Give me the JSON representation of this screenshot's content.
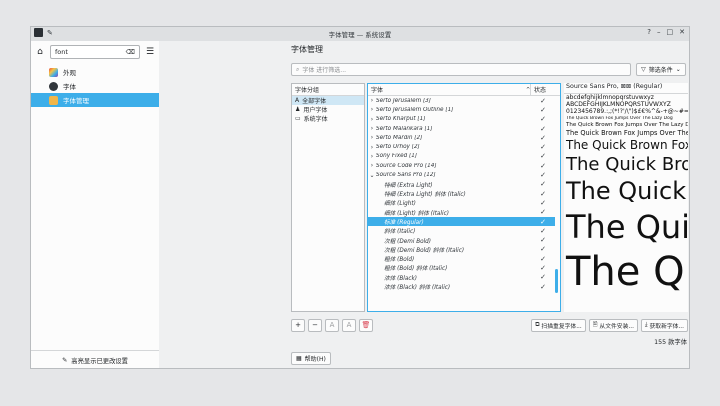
{
  "window": {
    "title": "字体管理 — 系统设置",
    "controls": [
      "?",
      "–",
      "□",
      "✕"
    ]
  },
  "sidebar": {
    "search_value": "font",
    "items": [
      {
        "label": "外观",
        "icon": "appearance-icon",
        "color": "#e94f3c"
      },
      {
        "label": "字体",
        "icon": "fonts-icon",
        "color": "#31363b"
      },
      {
        "label": "字体管理",
        "icon": "font-manager-icon",
        "color": "#f0b64a"
      }
    ],
    "footer": "高亮显示已更改设置"
  },
  "page": {
    "title": "字体管理",
    "filter_placeholder": "字体 进行筛选...",
    "filter_button": "筛选条件"
  },
  "groups": {
    "header": "字体分组",
    "items": [
      {
        "label": "全部字体",
        "icon": "A"
      },
      {
        "label": "用户字体",
        "icon": "♟"
      },
      {
        "label": "系统字体",
        "icon": "▭"
      }
    ]
  },
  "fontlist": {
    "col_font": "字体",
    "col_status": "状态",
    "rows": [
      {
        "name": "Serto Jerusalem [3]",
        "chev": "›",
        "sub": false
      },
      {
        "name": "Serto Jerusalem Outline [1]",
        "chev": "›",
        "sub": false
      },
      {
        "name": "Serto Kharput [1]",
        "chev": "›",
        "sub": false
      },
      {
        "name": "Serto Malankara [1]",
        "chev": "›",
        "sub": false
      },
      {
        "name": "Serto Mardin [2]",
        "chev": "›",
        "sub": false
      },
      {
        "name": "Serto Urhoy [2]",
        "chev": "›",
        "sub": false
      },
      {
        "name": "Sony Fixed [1]",
        "chev": "›",
        "sub": false
      },
      {
        "name": "Source Code Pro [14]",
        "chev": "›",
        "sub": false
      },
      {
        "name": "Source Sans Pro [12]",
        "chev": "⌄",
        "sub": false
      },
      {
        "name": "特细 (Extra Light)",
        "chev": "",
        "sub": true
      },
      {
        "name": "特细 (Extra Light) 斜体 (Italic)",
        "chev": "",
        "sub": true
      },
      {
        "name": "细体 (Light)",
        "chev": "",
        "sub": true
      },
      {
        "name": "细体 (Light) 斜体 (Italic)",
        "chev": "",
        "sub": true
      },
      {
        "name": "标准 (Regular)",
        "chev": "",
        "sub": true,
        "selected": true
      },
      {
        "name": "斜体 (Italic)",
        "chev": "",
        "sub": true
      },
      {
        "name": "次粗 (Demi Bold)",
        "chev": "",
        "sub": true
      },
      {
        "name": "次粗 (Demi Bold) 斜体 (Italic)",
        "chev": "",
        "sub": true
      },
      {
        "name": "粗体 (Bold)",
        "chev": "",
        "sub": true
      },
      {
        "name": "粗体 (Bold) 斜体 (Italic)",
        "chev": "",
        "sub": true
      },
      {
        "name": "浓体 (Black)",
        "chev": "",
        "sub": true
      },
      {
        "name": "浓体 (Black) 斜体 (Italic)",
        "chev": "",
        "sub": true
      }
    ],
    "check": "✓"
  },
  "preview": {
    "title": "Source Sans Pro, ⊠⊠ (Regular)",
    "lines": [
      "abcdefghijklmnopqrstuvwxyz",
      "ABCDEFGHIJKLMNOPQRSTUVWXYZ",
      "0123456789.:,;(*!?'/\\\")$£€%^&-+@~#=",
      "The Quick Brown Fox Jumps Over The Lazy Dog",
      "The Quick Brown Fox Jumps Over The Lazy Dog",
      "The Quick Brown Fox Jumps Over The Lazy Dog",
      "The Quick Brown Fox",
      "The Quick Brown",
      "The Quick",
      "The Quick",
      "The Qu"
    ]
  },
  "toolbar": {
    "add": "+",
    "remove": "−",
    "enable": "A",
    "disable": "A",
    "delete": "🗑",
    "scan": "扫描重复字体...",
    "install": "从文件安装...",
    "get_new": "获取新字体..."
  },
  "count": "155 款字体",
  "help": "帮助(H)"
}
